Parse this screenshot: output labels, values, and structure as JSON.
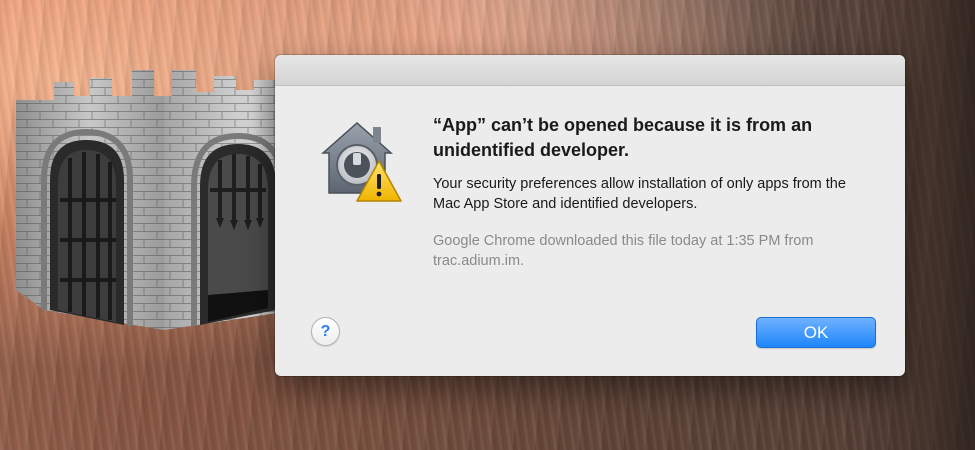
{
  "dialog": {
    "title": "“App” can’t be opened because it is from an unidentified developer.",
    "message": "Your security preferences allow installation of only apps from the Mac App Store and identified developers.",
    "info": "Google Chrome downloaded this file today at 1:35 PM from trac.adium.im.",
    "help_label": "?",
    "ok_label": "OK"
  },
  "icons": {
    "background_app": "gatekeeper-castle-icon",
    "dialog_icon": "security-house-lock-icon",
    "badge": "warning-triangle-icon"
  },
  "colors": {
    "accent": "#1e86fa",
    "help_glyph": "#2f7ef0",
    "warning": "#f5c518",
    "dialog_bg": "#ececec"
  }
}
